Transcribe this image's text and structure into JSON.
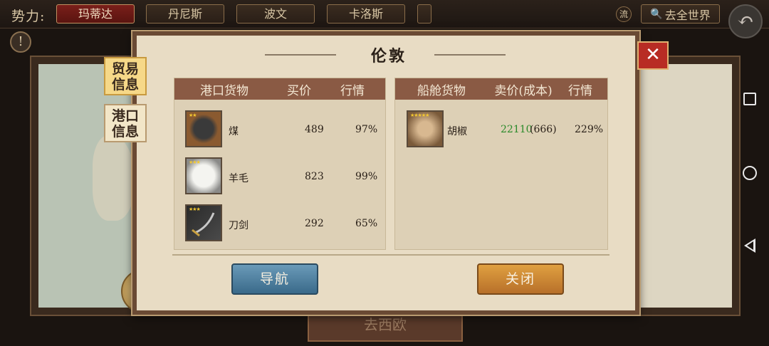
{
  "topbar": {
    "faction_label": "势力:",
    "factions": [
      "玛蒂达",
      "丹尼斯",
      "波文",
      "卡洛斯"
    ],
    "stream_label": "流",
    "world_button": "去全世界"
  },
  "sidebar": {
    "tabs": [
      {
        "label": "贸易信息",
        "active": true
      },
      {
        "label": "港口信息",
        "active": false
      }
    ]
  },
  "dialog": {
    "title": "伦敦",
    "port_panel": {
      "headers": [
        "港口货物",
        "买价",
        "行情"
      ],
      "rows": [
        {
          "icon": "coal-icon",
          "stars": 2,
          "name": "煤",
          "price": "489",
          "market": "97%"
        },
        {
          "icon": "wool-icon",
          "stars": 3,
          "name": "羊毛",
          "price": "823",
          "market": "99%"
        },
        {
          "icon": "sword-icon",
          "stars": 3,
          "name": "刀剑",
          "price": "292",
          "market": "65%"
        }
      ]
    },
    "ship_panel": {
      "headers": [
        "船舱货物",
        "卖价(成本)",
        "行情"
      ],
      "rows": [
        {
          "icon": "pepper-icon",
          "stars": 5,
          "name": "胡椒",
          "price": "22110",
          "cost": "(666)",
          "market": "229%"
        }
      ]
    },
    "navigate_button": "导航",
    "close_button": "关闭"
  },
  "background": {
    "banner": "去西欧"
  },
  "colors": {
    "profit_green": "#2a8a2a",
    "header_brown": "#8a5a44",
    "close_red": "#b82c24"
  }
}
